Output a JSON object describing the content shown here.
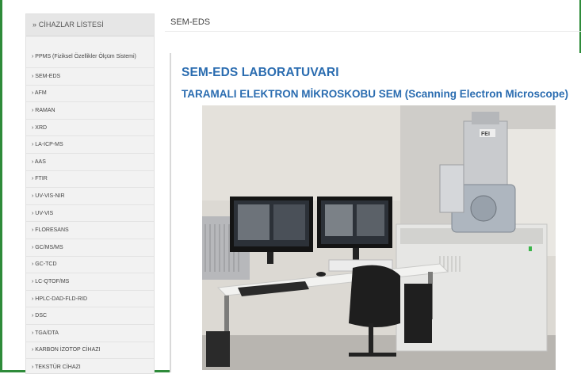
{
  "sidebar": {
    "header": "» CİHAZLAR LİSTESİ",
    "items": [
      {
        "label": "› PPMS (Fiziksel Özellikler Ölçüm Sistemi)"
      },
      {
        "label": "› SEM-EDS"
      },
      {
        "label": "› AFM"
      },
      {
        "label": "› RAMAN"
      },
      {
        "label": "› XRD"
      },
      {
        "label": "› LA-ICP-MS"
      },
      {
        "label": "› AAS"
      },
      {
        "label": "› FTIR"
      },
      {
        "label": "› UV-VIS-NIR"
      },
      {
        "label": "› UV-VIS"
      },
      {
        "label": "› FLORESANS"
      },
      {
        "label": "› GC/MS/MS"
      },
      {
        "label": "› GC-TCD"
      },
      {
        "label": "› LC-QTOF/MS"
      },
      {
        "label": "› HPLC-DAD-FLD-RID"
      },
      {
        "label": "› DSC"
      },
      {
        "label": "› TGA/DTA"
      },
      {
        "label": "› KARBON İZOTOP CİHAZI"
      },
      {
        "label": "› TEKSTÜR CİHAZI"
      }
    ]
  },
  "page": {
    "title": "SEM-EDS",
    "heading": "SEM-EDS LABORATUVARI",
    "subheading": "TARAMALI ELEKTRON MİKROSKOBU SEM (Scanning Electron Microscope)"
  },
  "photo": {
    "logo_text": "FEI"
  },
  "colors": {
    "frame_border": "#2e8b3a",
    "heading_blue": "#2a6cb0"
  }
}
